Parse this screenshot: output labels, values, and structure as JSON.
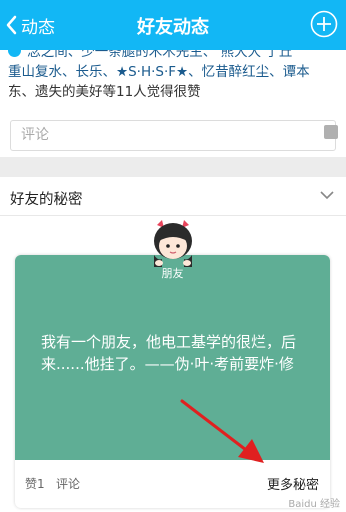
{
  "header": {
    "back_label": "动态",
    "title": "好友动态"
  },
  "likes": {
    "line1": "念之间、少一条腿的木木先生、",
    "line1_b": "熊大大",
    "line1_c": " 了丘",
    "line2": "重山复水、长乐、★S·H·S·F★、忆昔醉红尘、谭本",
    "line3": "东、遗失的美好等11人觉得很赞"
  },
  "comment": {
    "placeholder": "评论"
  },
  "section": {
    "title": "好友的秘密"
  },
  "card": {
    "tag": "朋友",
    "text": "我有一个朋友，他电工基学的很烂，后来......他挂了。——伪·叶·考前要炸·修",
    "bg_color": "#5fae95",
    "like_label": "赞1",
    "comment_label": "评论",
    "more_label": "更多秘密"
  },
  "accent_color": "#12b7f5",
  "watermark": "Baidu 经验"
}
